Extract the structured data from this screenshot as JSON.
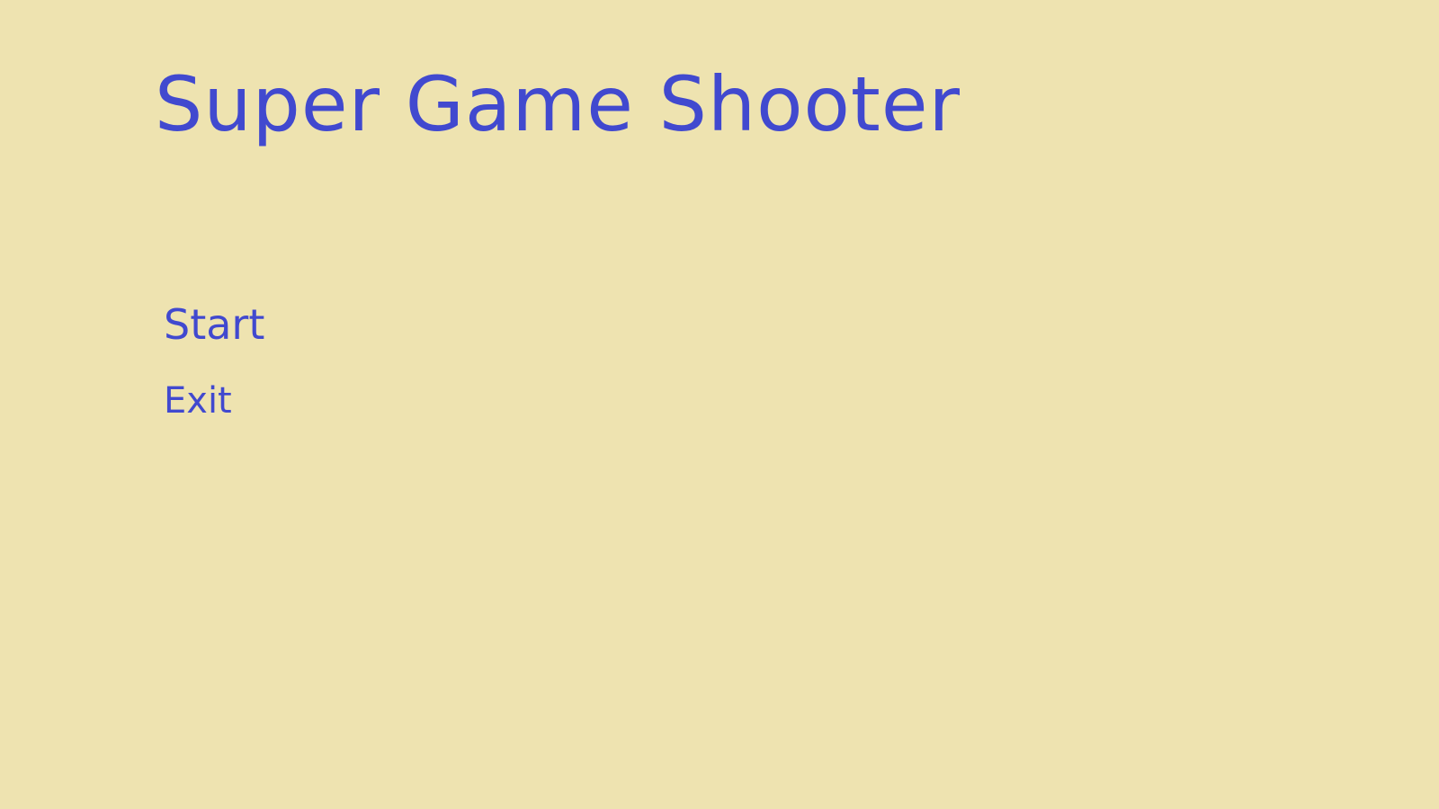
{
  "screen": {
    "background_color": "#EEE3B0",
    "text_color": "#4149CF"
  },
  "title": "Super Game Shooter",
  "menu": {
    "start_label": "Start",
    "exit_label": "Exit"
  }
}
